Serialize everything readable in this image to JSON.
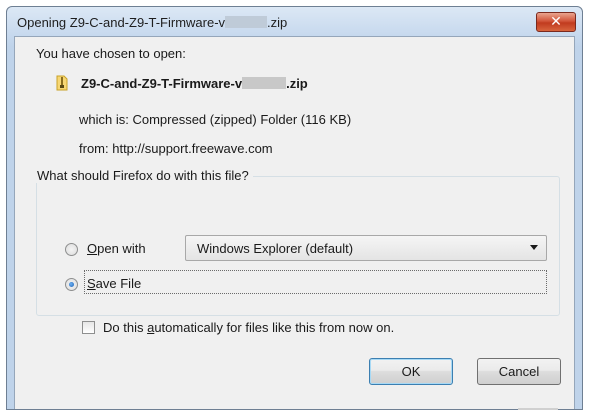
{
  "window": {
    "title_prefix": "Opening Z9-C-and-Z9-T-Firmware-v",
    "title_suffix": ".zip",
    "close_label": "✕"
  },
  "dialog": {
    "prompt": "You have chosen to open:",
    "file_name_prefix": "Z9-C-and-Z9-T-Firmware-v",
    "file_name_suffix": ".zip",
    "which_is": "which is: Compressed (zipped) Folder (116 KB)",
    "from": "from: http://support.freewave.com",
    "question": "What should Firefox do with this file?",
    "open_with": {
      "mnemonic": "O",
      "label_rest": "pen with",
      "selected": false,
      "app_selected": "Windows Explorer (default)"
    },
    "save_file": {
      "mnemonic": "S",
      "label_rest": "ave File",
      "selected": true
    },
    "auto_checkbox": {
      "label_before": "Do this ",
      "mnemonic": "a",
      "label_after": "utomatically for files like this from now on.",
      "checked": false
    },
    "buttons": {
      "ok": "OK",
      "cancel": "Cancel"
    }
  },
  "icons": {
    "file": "zip-folder-icon",
    "close": "close-icon",
    "dropdown": "chevron-down-icon"
  },
  "colors": {
    "titlebar": "#c7d9ee",
    "close_button": "#c13b1f",
    "client_bg": "#f0f0f0",
    "radio_dot": "#1a5fb4"
  }
}
